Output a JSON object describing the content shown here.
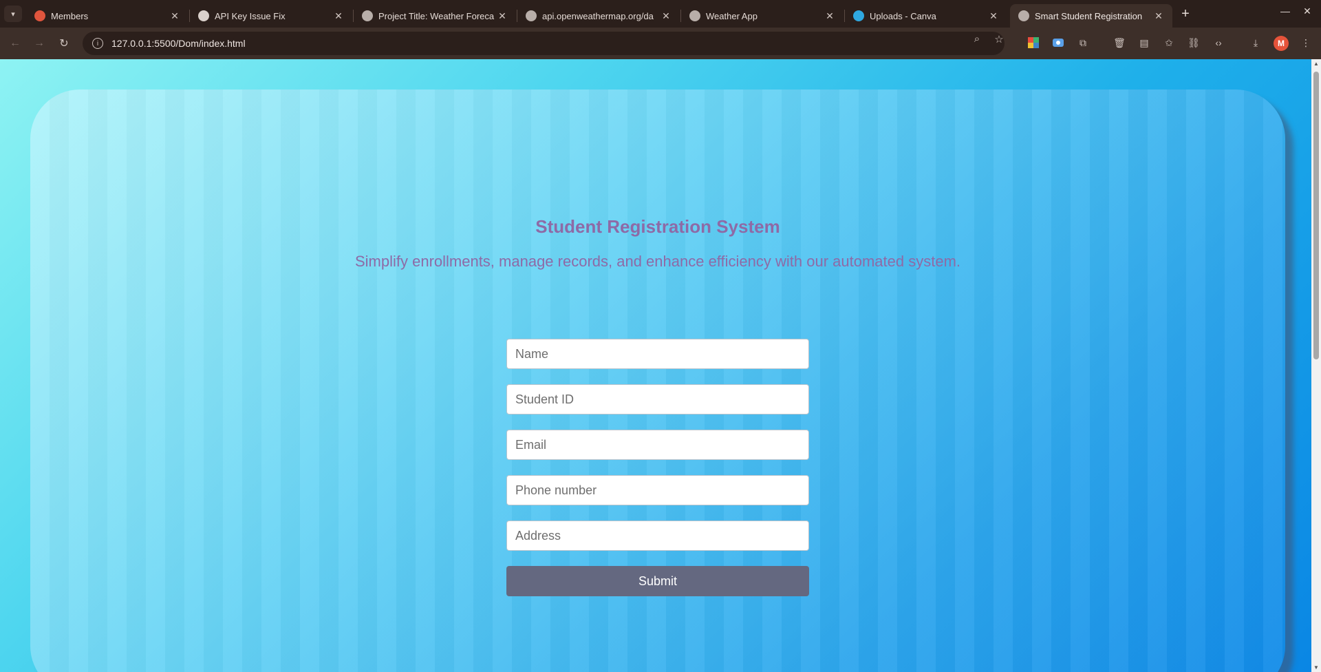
{
  "browser": {
    "tabs": [
      {
        "title": "Members",
        "favicon_color": "#e0553d"
      },
      {
        "title": "API Key Issue Fix",
        "favicon_color": "#d9d0cb"
      },
      {
        "title": "Project Title: Weather Foreca",
        "favicon_color": "#b8aea9"
      },
      {
        "title": "api.openweathermap.org/da",
        "favicon_color": "#b8aea9"
      },
      {
        "title": "Weather App",
        "favicon_color": "#b8aea9"
      },
      {
        "title": "Uploads - Canva",
        "favicon_color": "#2fa8e0"
      },
      {
        "title": "Smart Student Registration",
        "favicon_color": "#b8aea9",
        "active": true
      }
    ],
    "url": "127.0.0.1:5500/Dom/index.html",
    "profile_initial": "M"
  },
  "page": {
    "title": "Student Registration System",
    "subtitle": "Simplify enrollments, manage records, and enhance efficiency with our automated system.",
    "form": {
      "name_placeholder": "Name",
      "student_id_placeholder": "Student ID",
      "email_placeholder": "Email",
      "phone_placeholder": "Phone number",
      "address_placeholder": "Address",
      "submit_label": "Submit"
    },
    "colors": {
      "heading": "#8e6aa6",
      "button": "#646880"
    }
  }
}
